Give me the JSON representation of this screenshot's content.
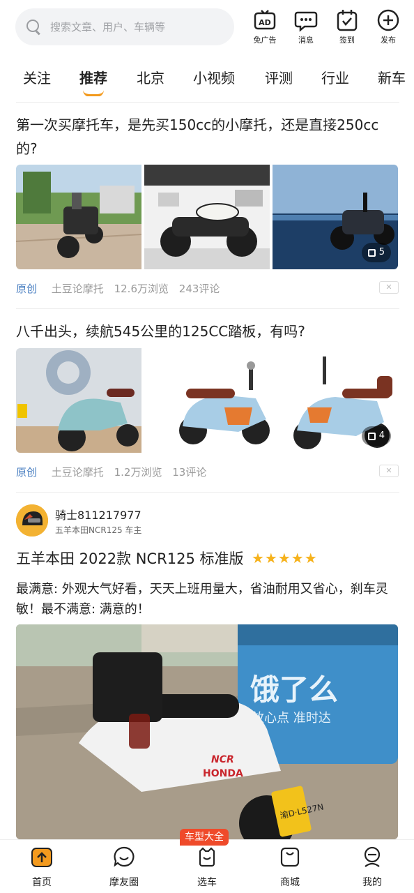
{
  "search": {
    "placeholder": "搜索文章、用户、车辆等"
  },
  "top_actions": [
    {
      "label": "免广告",
      "icon": "ad-icon"
    },
    {
      "label": "消息",
      "icon": "message-icon"
    },
    {
      "label": "签到",
      "icon": "checkin-icon"
    },
    {
      "label": "发布",
      "icon": "plus-icon"
    }
  ],
  "tabs": [
    "关注",
    "推荐",
    "北京",
    "小视频",
    "评测",
    "行业",
    "新车"
  ],
  "active_tab": "推荐",
  "articles": [
    {
      "title": "第一次买摩托车，是先买150cc的小摩托，还是直接250cc的?",
      "image_count": "5",
      "tag": "原创",
      "author": "土豆论摩托",
      "views": "12.6万浏览",
      "comments": "243评论"
    },
    {
      "title": "八千出头，续航545公里的125CC踏板，有吗?",
      "image_count": "4",
      "tag": "原创",
      "author": "土豆论摩托",
      "views": "1.2万浏览",
      "comments": "13评论"
    }
  ],
  "review": {
    "username": "骑士811217977",
    "owner_of": "五羊本田NCR125 车主",
    "model": "五羊本田 2022款 NCR125 标准版",
    "rating": 5,
    "stars": "★★★★★",
    "text": "最满意: 外观大气好看，天天上班用量大，省油耐用又省心，刹车灵敏！最不满意: 满意的！",
    "image_texts": {
      "box_brand": "饿了么",
      "box_slogan": "放心点 准时达",
      "bike_brand": "HONDA",
      "bike_model": "NCR",
      "plate": "渝D·L527N"
    }
  },
  "close_label": "✕",
  "car_badge": "车型大全",
  "bottom_nav": [
    {
      "label": "首页",
      "icon": "home-icon",
      "active": true
    },
    {
      "label": "摩友圈",
      "icon": "chat-icon",
      "active": false
    },
    {
      "label": "选车",
      "icon": "car-select-icon",
      "active": false
    },
    {
      "label": "商城",
      "icon": "shop-bag-icon",
      "active": false
    },
    {
      "label": "我的",
      "icon": "profile-icon",
      "active": false
    }
  ],
  "colors": {
    "accent": "#f39a1e",
    "link": "#4a7fc1",
    "badge": "#ef4a2a",
    "star": "#f6b21c"
  }
}
